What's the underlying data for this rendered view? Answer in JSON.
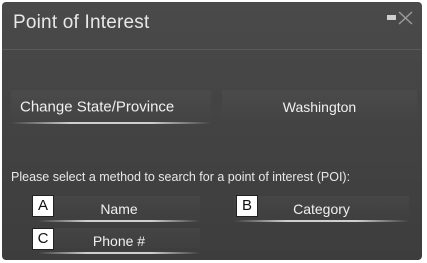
{
  "header": {
    "title": "Point of Interest",
    "status_icon": "signal-icon"
  },
  "state": {
    "change_label": "Change State/Province",
    "current_value": "Washington"
  },
  "search": {
    "prompt": "Please select a method to search for a point of interest (POI):",
    "options": [
      {
        "label": "Name",
        "callout": "A"
      },
      {
        "label": "Category",
        "callout": "B"
      },
      {
        "label": "Phone #",
        "callout": "C"
      }
    ]
  },
  "colors": {
    "screen_bg": "#444444",
    "text": "#f0f0f0",
    "underline": "#cfcfcf"
  }
}
